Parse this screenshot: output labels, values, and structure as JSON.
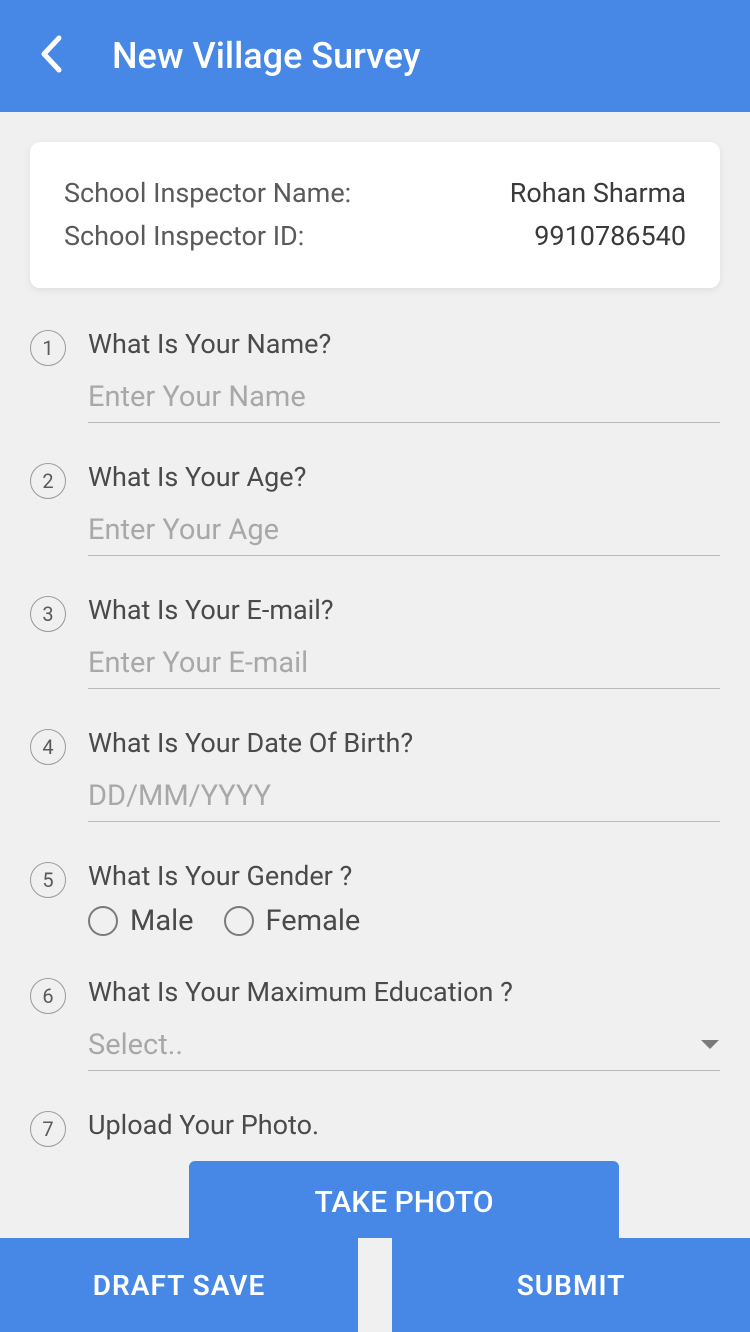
{
  "header": {
    "title": "New Village Survey"
  },
  "inspector": {
    "name_label": "School Inspector Name:",
    "name_value": "Rohan Sharma",
    "id_label": "School Inspector ID:",
    "id_value": "9910786540"
  },
  "questions": [
    {
      "number": "1",
      "label": "What Is Your Name?",
      "placeholder": "Enter Your Name"
    },
    {
      "number": "2",
      "label": "What Is Your Age?",
      "placeholder": "Enter Your Age"
    },
    {
      "number": "3",
      "label": "What Is Your E-mail?",
      "placeholder": "Enter Your E-mail"
    },
    {
      "number": "4",
      "label": "What Is Your Date Of Birth?",
      "placeholder": "DD/MM/YYYY"
    },
    {
      "number": "5",
      "label": "What Is Your Gender ?",
      "options": [
        "Male",
        "Female"
      ]
    },
    {
      "number": "6",
      "label": "What Is Your Maximum Education ?",
      "placeholder": "Select.."
    },
    {
      "number": "7",
      "label": "Upload Your Photo."
    }
  ],
  "buttons": {
    "take_photo": "TAKE PHOTO",
    "draft_save": "DRAFT SAVE",
    "submit": "SUBMIT"
  }
}
